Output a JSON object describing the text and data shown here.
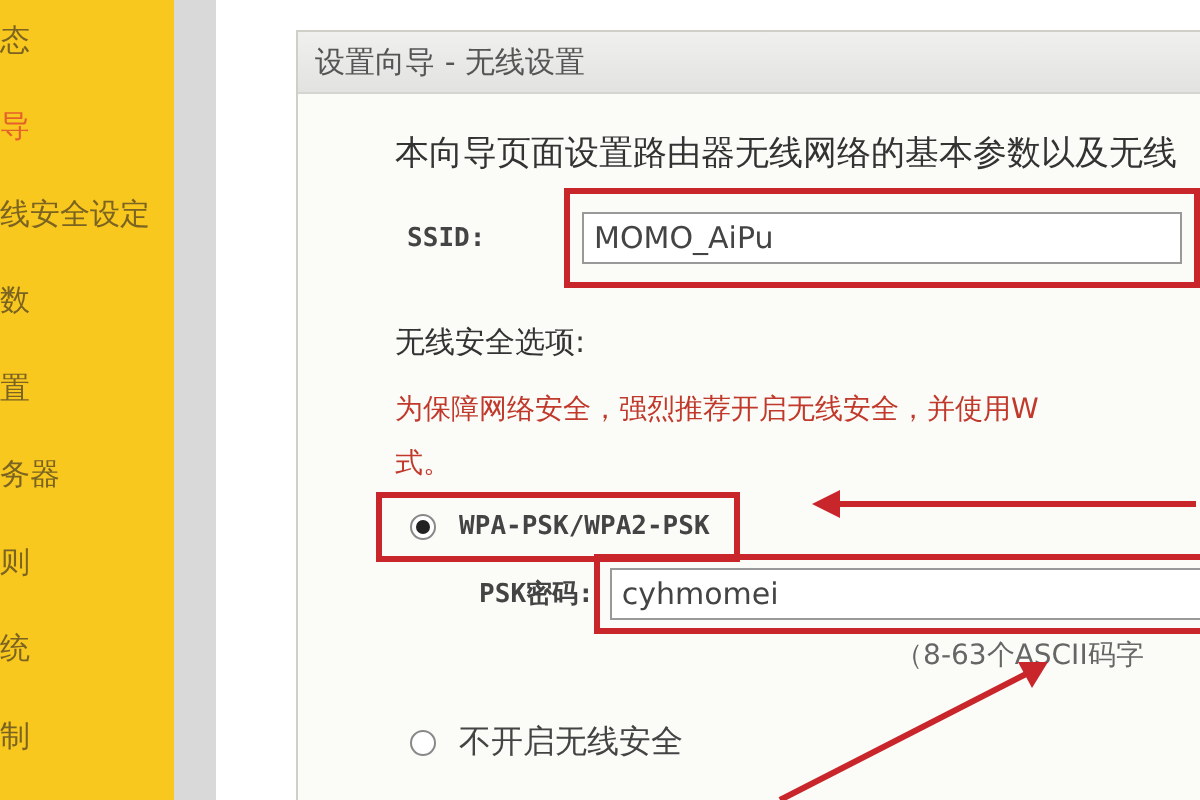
{
  "sidebar": {
    "items": [
      {
        "label": "态",
        "selected": false
      },
      {
        "label": "导",
        "selected": true
      },
      {
        "label": "线安全设定",
        "selected": false
      },
      {
        "label": "数",
        "selected": false
      },
      {
        "label": "置",
        "selected": false
      },
      {
        "label": "务器",
        "selected": false
      },
      {
        "label": "则",
        "selected": false
      },
      {
        "label": "统",
        "selected": false
      },
      {
        "label": "制",
        "selected": false
      }
    ]
  },
  "panel": {
    "title": "设置向导 - 无线设置",
    "intro": "本向导页面设置路由器无线网络的基本参数以及无线",
    "ssid": {
      "label": "SSID:",
      "value": "MOMO_AiPu",
      "highlighted": true
    },
    "security_heading": "无线安全选项:",
    "warning": [
      "为保障网络安全，强烈推荐开启无线安全，并使用W",
      "式。"
    ],
    "options": [
      {
        "label": "WPA-PSK/WPA2-PSK",
        "selected": true,
        "highlighted": true
      },
      {
        "label": "不开启无线安全",
        "selected": false,
        "highlighted": false
      }
    ],
    "psk": {
      "label": "PSK密码:",
      "value": "cyhmomei",
      "hint": "（8-63个ASCII码字",
      "highlighted": true
    }
  }
}
